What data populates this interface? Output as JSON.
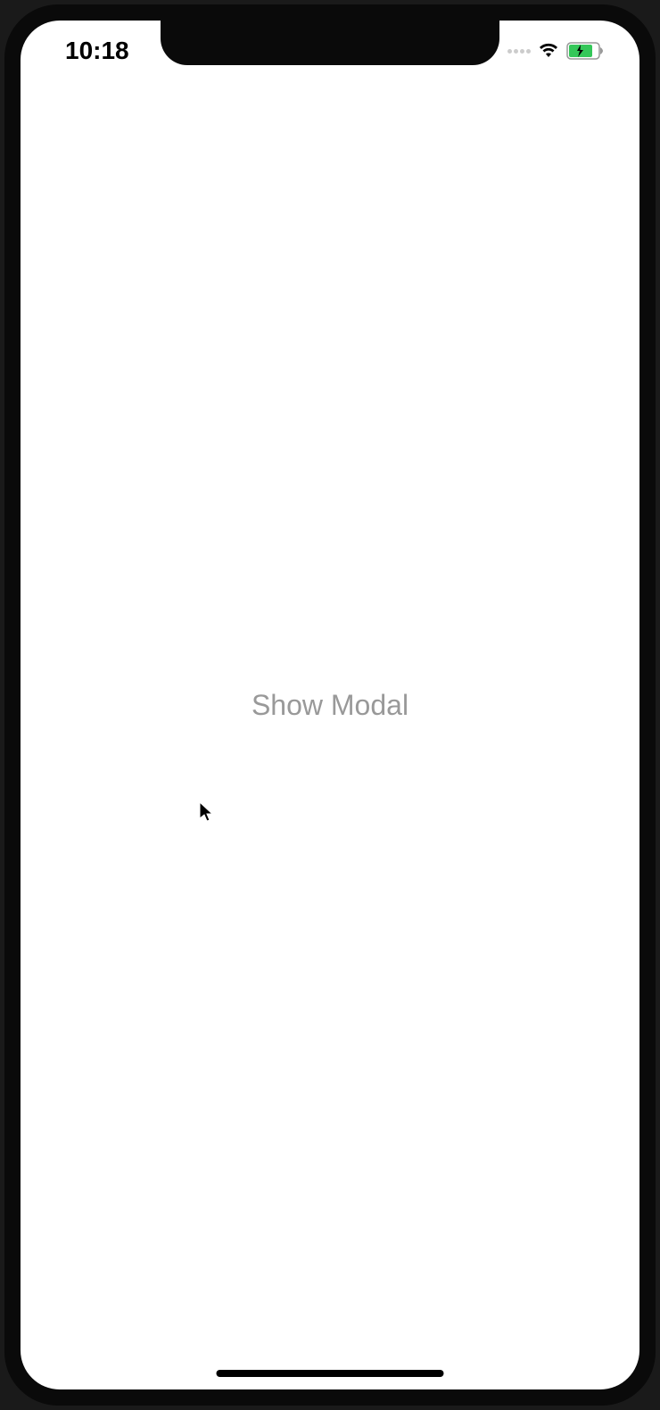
{
  "status_bar": {
    "time": "10:18"
  },
  "main": {
    "show_modal_label": "Show Modal"
  }
}
